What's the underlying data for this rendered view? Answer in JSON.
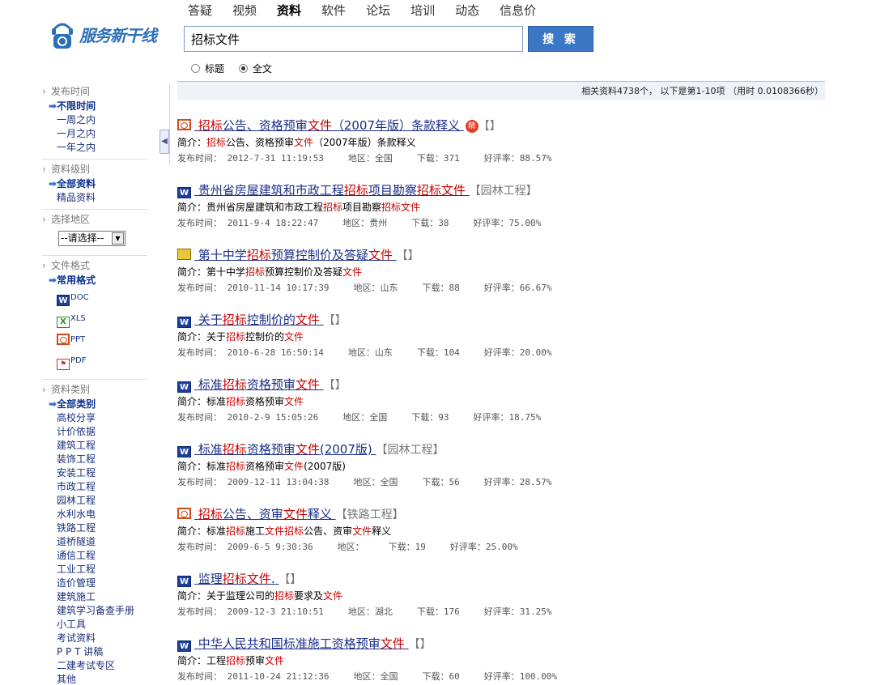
{
  "logo": {
    "text": "服务新干线"
  },
  "nav": [
    "答疑",
    "视频",
    "资料",
    "软件",
    "论坛",
    "培训",
    "动态",
    "信息价"
  ],
  "nav_active": "资料",
  "search": {
    "value": "招标文件",
    "button": "搜 索"
  },
  "scope": {
    "title_label": "标题",
    "fulltext_label": "全文",
    "selected": "全文"
  },
  "stats": "相关资料4738个， 以下是第1-10项 （用时 0.0108366秒）",
  "sidebar": {
    "time": {
      "title": "发布时间",
      "selected": "不限时间",
      "options": [
        "一周之内",
        "一月之内",
        "一年之内"
      ]
    },
    "level": {
      "title": "资料级别",
      "selected": "全部资料",
      "options": [
        "精品资料"
      ]
    },
    "region": {
      "title": "选择地区",
      "select": "--请选择--"
    },
    "format": {
      "title": "文件格式",
      "selected": "常用格式",
      "options": [
        "DOC",
        "XLS",
        "PPT",
        "PDF"
      ]
    },
    "category": {
      "title": "资料类别",
      "selected": "全部类别",
      "options": [
        "高校分享",
        "计价依据",
        "建筑工程",
        "装饰工程",
        "安装工程",
        "市政工程",
        "园林工程",
        "水利水电",
        "铁路工程",
        "道桥隧道",
        "通信工程",
        "工业工程",
        "造价管理",
        "建筑施工",
        "建筑学习备查手册",
        "小工具",
        "考试资料",
        "P P T 讲稿",
        "二建考试专区",
        "其他"
      ]
    }
  },
  "results": [
    {
      "icon": "ppt-icon",
      "title": [
        [
          "招标",
          1
        ],
        [
          "公告、资格预审",
          0
        ],
        [
          "文件",
          1
        ],
        [
          "（2007年版）条款释义",
          0
        ]
      ],
      "jing": "精",
      "cat": "【】",
      "intro": [
        [
          "简介：",
          0
        ],
        [
          "招标",
          1
        ],
        [
          "公告、资格预审",
          0
        ],
        [
          "文件",
          1
        ],
        [
          "（2007年版）条款释义",
          0
        ]
      ],
      "date": "发布时间： 2012-7-31 11:19:53",
      "region": "地区：全国",
      "downloads": "下载：371",
      "rating": "好评率：88.57%"
    },
    {
      "icon": "word-icon",
      "title": [
        [
          "贵州省房屋建筑和市政工程",
          0
        ],
        [
          "招标",
          1
        ],
        [
          "项目勘察",
          0
        ],
        [
          "招标",
          1
        ],
        [
          "文件",
          1
        ]
      ],
      "cat": "【园林工程】",
      "intro": [
        [
          "简介：贵州省房屋建筑和市政工程",
          0
        ],
        [
          "招标",
          1
        ],
        [
          "项目勘察",
          0
        ],
        [
          "招标文件",
          1
        ]
      ],
      "date": "发布时间： 2011-9-4 18:22:47",
      "region": "地区：贵州",
      "downloads": "下载：38",
      "rating": "好评率：75.00%"
    },
    {
      "icon": "zip-icon",
      "title": [
        [
          "第十中学",
          0
        ],
        [
          "招标",
          1
        ],
        [
          "预算控制价及答疑",
          0
        ],
        [
          "文件",
          1
        ]
      ],
      "cat": "【】",
      "intro": [
        [
          "简介：第十中学",
          0
        ],
        [
          "招标",
          1
        ],
        [
          "预算控制价及答疑",
          0
        ],
        [
          "文件",
          1
        ]
      ],
      "date": "发布时间： 2010-11-14 10:17:39",
      "region": "地区：山东",
      "downloads": "下载：88",
      "rating": "好评率：66.67%"
    },
    {
      "icon": "word-icon",
      "title": [
        [
          "关于",
          0
        ],
        [
          "招标",
          1
        ],
        [
          "控制价的",
          0
        ],
        [
          "文件",
          1
        ]
      ],
      "cat": "【】",
      "intro": [
        [
          "简介：关于",
          0
        ],
        [
          "招标",
          1
        ],
        [
          "控制价的",
          0
        ],
        [
          "文件",
          1
        ]
      ],
      "date": "发布时间： 2010-6-28 16:50:14",
      "region": "地区：山东",
      "downloads": "下载：104",
      "rating": "好评率：20.00%"
    },
    {
      "icon": "word-icon",
      "title": [
        [
          "标准",
          0
        ],
        [
          "招标",
          1
        ],
        [
          "资格预审",
          0
        ],
        [
          "文件",
          1
        ]
      ],
      "cat": "【】",
      "intro": [
        [
          "简介：标准",
          0
        ],
        [
          "招标",
          1
        ],
        [
          "资格预审",
          0
        ],
        [
          "文件",
          1
        ]
      ],
      "date": "发布时间： 2010-2-9 15:05:26",
      "region": "地区：全国",
      "downloads": "下载：93",
      "rating": "好评率：18.75%"
    },
    {
      "icon": "word-icon",
      "title": [
        [
          "标准",
          0
        ],
        [
          "招标",
          1
        ],
        [
          "资格预审",
          0
        ],
        [
          "文件",
          1
        ],
        [
          "(2007版)",
          0
        ]
      ],
      "cat": "【园林工程】",
      "intro": [
        [
          "简介：标准",
          0
        ],
        [
          "招标",
          1
        ],
        [
          "资格预审",
          0
        ],
        [
          "文件",
          1
        ],
        [
          "(2007版)",
          0
        ]
      ],
      "date": "发布时间： 2009-12-11 13:04:38",
      "region": "地区：全国",
      "downloads": "下载：56",
      "rating": "好评率：28.57%"
    },
    {
      "icon": "ppt-icon",
      "title": [
        [
          "招标",
          1
        ],
        [
          "公告、资审",
          0
        ],
        [
          "文件",
          1
        ],
        [
          "释义",
          0
        ]
      ],
      "cat": "【铁路工程】",
      "intro": [
        [
          "简介：标准",
          0
        ],
        [
          "招标",
          1
        ],
        [
          "施工",
          0
        ],
        [
          "文件招标",
          1
        ],
        [
          "公告、资审",
          0
        ],
        [
          "文件",
          1
        ],
        [
          "释义",
          0
        ]
      ],
      "date": "发布时间： 2009-6-5 9:30:36",
      "region": "地区：",
      "downloads": "下载：19",
      "rating": "好评率：25.00%"
    },
    {
      "icon": "word-icon",
      "title": [
        [
          "监理",
          0
        ],
        [
          "招标文件",
          1
        ],
        [
          ".",
          0
        ]
      ],
      "cat": "【】",
      "intro": [
        [
          "简介：关于监理公司的",
          0
        ],
        [
          "招标",
          1
        ],
        [
          "要求及",
          0
        ],
        [
          "文件",
          1
        ]
      ],
      "date": "发布时间： 2009-12-3 21:10:51",
      "region": "地区：湖北",
      "downloads": "下载：176",
      "rating": "好评率：31.25%"
    },
    {
      "icon": "word-icon",
      "title": [
        [
          "中华人民共和国标准施工资格预审",
          0
        ],
        [
          "文件",
          1
        ]
      ],
      "cat": "【】",
      "intro": [
        [
          "简介：工程",
          0
        ],
        [
          "招标",
          1
        ],
        [
          "预审",
          0
        ],
        [
          "文件",
          1
        ]
      ],
      "date": "发布时间： 2011-10-24 21:12:36",
      "region": "地区：全国",
      "downloads": "下载：60",
      "rating": "好评率：100.00%"
    }
  ]
}
